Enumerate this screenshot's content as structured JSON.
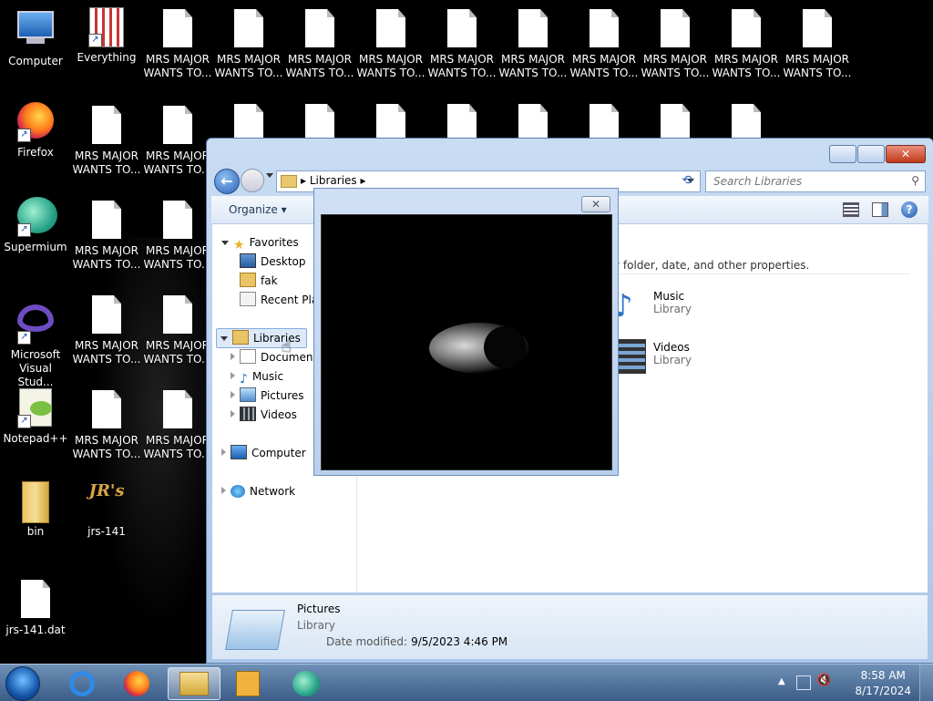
{
  "desktop": {
    "icons": [
      {
        "label": "Computer"
      },
      {
        "label": "Everything"
      },
      {
        "label": "MRS MAJOR WANTS TO..."
      },
      {
        "label": "Firefox"
      },
      {
        "label": "Supermium"
      },
      {
        "label": "Microsoft Visual Stud..."
      },
      {
        "label": "Notepad++"
      },
      {
        "label": "bin"
      },
      {
        "label": "jrs-141"
      },
      {
        "label": "jrs-141.dat"
      }
    ],
    "jrs_logo_text": "JR's"
  },
  "explorer": {
    "address_crumb": "Libraries",
    "search_placeholder": "Search Libraries",
    "organize_label": "Organize",
    "nav": {
      "favorites": "Favorites",
      "desktop": "Desktop",
      "fak": "fak",
      "recent_places": "Recent Plac",
      "libraries": "Libraries",
      "documents": "Documents",
      "music": "Music",
      "pictures": "Pictures",
      "videos": "Videos",
      "computer": "Computer",
      "network": "Network"
    },
    "main_text": "y folder, date, and other properties.",
    "tiles": [
      {
        "name": "Music",
        "sub": "Library"
      },
      {
        "name": "Videos",
        "sub": "Library"
      }
    ],
    "details": {
      "name": "Pictures",
      "type": "Library",
      "date_label": "Date modified:",
      "date_value": "9/5/2023 4:46 PM"
    }
  },
  "dialog": {
    "close_glyph": "✕"
  },
  "taskbar": {
    "time": "8:58 AM",
    "date": "8/17/2024"
  },
  "colors": {
    "accent": "#2a62b8",
    "taskbar": "#4c6d96",
    "window_frame": "#b8d0ee"
  }
}
